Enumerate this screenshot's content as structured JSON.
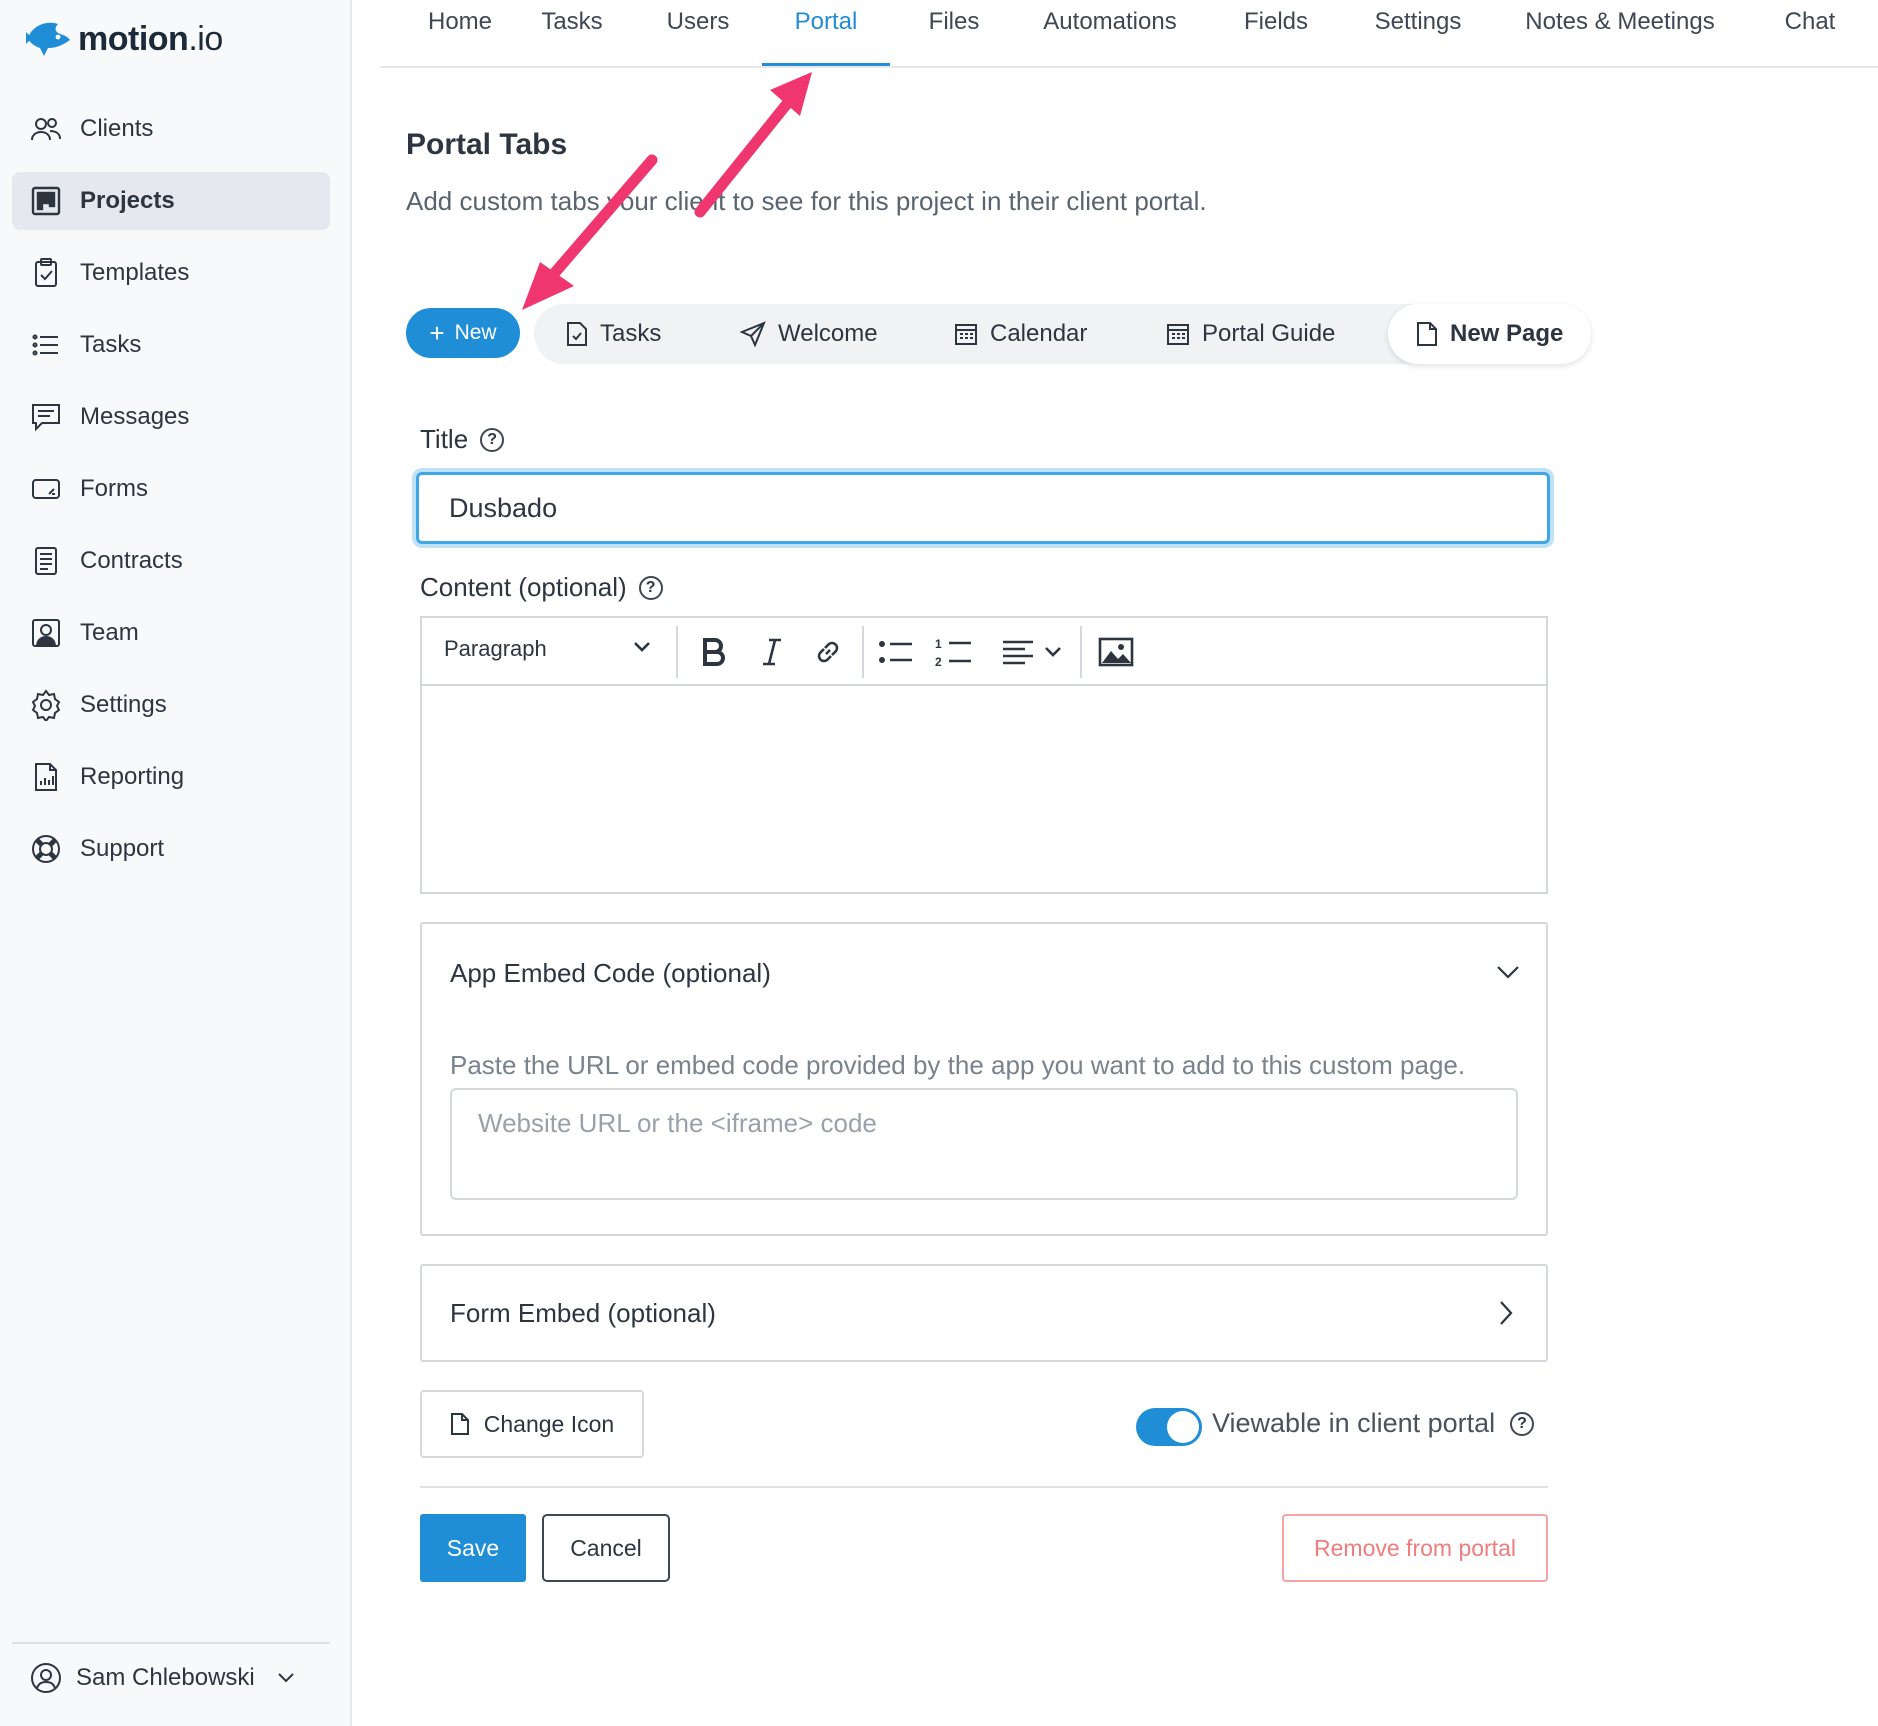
{
  "brand": {
    "name": "motion",
    "suffix": ".io",
    "accent": "#1f8ed6"
  },
  "sidebar": {
    "items": [
      {
        "label": "Clients",
        "icon": "users-icon",
        "active": false
      },
      {
        "label": "Projects",
        "icon": "kanban-icon",
        "active": true
      },
      {
        "label": "Templates",
        "icon": "clipboard-check-icon",
        "active": false
      },
      {
        "label": "Tasks",
        "icon": "list-icon",
        "active": false
      },
      {
        "label": "Messages",
        "icon": "message-icon",
        "active": false
      },
      {
        "label": "Forms",
        "icon": "form-icon",
        "active": false
      },
      {
        "label": "Contracts",
        "icon": "document-icon",
        "active": false
      },
      {
        "label": "Team",
        "icon": "team-icon",
        "active": false
      },
      {
        "label": "Settings",
        "icon": "gear-icon",
        "active": false
      },
      {
        "label": "Reporting",
        "icon": "report-icon",
        "active": false
      },
      {
        "label": "Support",
        "icon": "lifebuoy-icon",
        "active": false
      }
    ],
    "user": {
      "name": "Sam Chlebowski"
    }
  },
  "topnav": {
    "tabs": [
      {
        "label": "Home",
        "active": false
      },
      {
        "label": "Tasks",
        "active": false
      },
      {
        "label": "Users",
        "active": false
      },
      {
        "label": "Portal",
        "active": true
      },
      {
        "label": "Files",
        "active": false
      },
      {
        "label": "Automations",
        "active": false
      },
      {
        "label": "Fields",
        "active": false
      },
      {
        "label": "Settings",
        "active": false
      },
      {
        "label": "Notes & Meetings",
        "active": false
      },
      {
        "label": "Chat",
        "active": false
      }
    ]
  },
  "page": {
    "title": "Portal Tabs",
    "subtitle": "Add custom tabs your client to see for this project in their client portal."
  },
  "portal_tabs": {
    "new_label": "New",
    "tabs": [
      {
        "label": "Tasks",
        "icon": "file-check-icon",
        "active": false
      },
      {
        "label": "Welcome",
        "icon": "send-icon",
        "active": false
      },
      {
        "label": "Calendar",
        "icon": "calendar-icon",
        "active": false
      },
      {
        "label": "Portal Guide",
        "icon": "calendar-icon",
        "active": false
      },
      {
        "label": "New Page",
        "icon": "file-icon",
        "active": true
      }
    ]
  },
  "form": {
    "title_label": "Title",
    "title_value": "Dusbado",
    "content_label": "Content (optional)",
    "editor": {
      "block_format": "Paragraph"
    },
    "app_embed": {
      "title": "App Embed Code (optional)",
      "hint": "Paste the URL or embed code provided by the app you want to add to this custom page.",
      "placeholder": "Website URL or the <iframe> code",
      "expanded": true
    },
    "form_embed": {
      "title": "Form Embed (optional)",
      "expanded": false
    },
    "change_icon_label": "Change Icon",
    "viewable_label": "Viewable in client portal",
    "viewable_on": true
  },
  "actions": {
    "save": "Save",
    "cancel": "Cancel",
    "remove": "Remove from portal"
  },
  "colors": {
    "accent": "#1f8ed6",
    "annotation_arrow": "#f0366e",
    "danger": "#ef7d7d"
  }
}
